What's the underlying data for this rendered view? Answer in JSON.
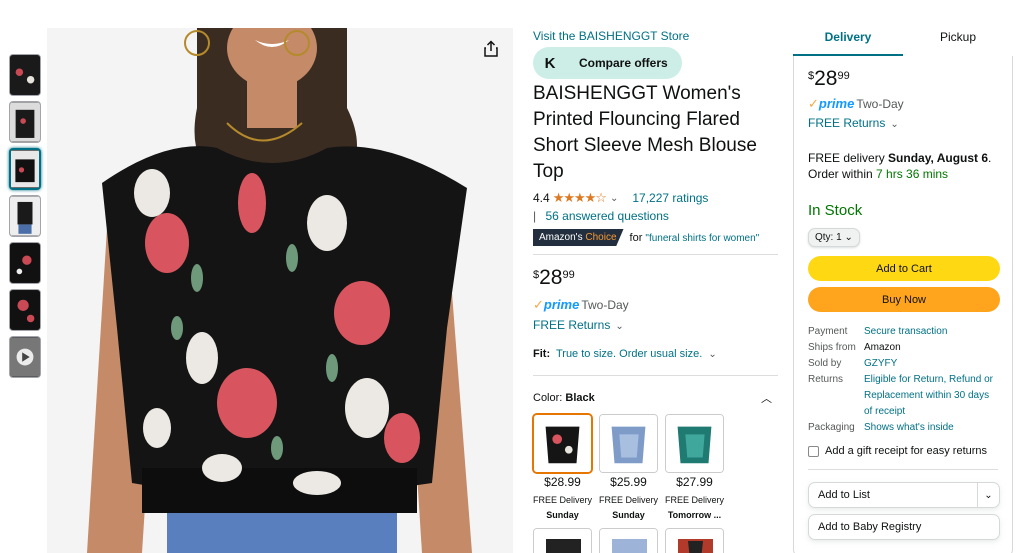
{
  "gallery": {
    "thumbnails": [
      "thumb-1",
      "thumb-2",
      "thumb-3",
      "thumb-4",
      "thumb-5",
      "thumb-6",
      "video-thumb"
    ],
    "share_icon": "share-icon"
  },
  "product": {
    "store_link": "Visit the BAISHENGGT Store",
    "compare_offers": "Compare offers",
    "compare_icon_letter": "K",
    "title": "BAISHENGGT Women's Printed Flouncing Flared Short Sleeve Mesh Blouse Top",
    "rating": "4.4",
    "stars": "★★★★☆",
    "ratings_count": "17,227 ratings",
    "answered_questions": "56 answered questions",
    "badge_prefix": "Amazon's",
    "badge_choice": "Choice",
    "badge_for": "for",
    "badge_query": "\"funeral shirts for women\"",
    "price_symbol": "$",
    "price_whole": "28",
    "price_fraction": "99",
    "prime": "prime",
    "two_day": "Two-Day",
    "free_returns": "FREE Returns",
    "fit_label": "Fit:",
    "fit_value": "True to size. Order usual size.",
    "color_label": "Color:",
    "color_value": "Black"
  },
  "swatches": [
    {
      "price": "$28.99",
      "delivery": "FREE Delivery",
      "day": "Sunday"
    },
    {
      "price": "$25.99",
      "delivery": "FREE Delivery",
      "day": "Sunday"
    },
    {
      "price": "$27.99",
      "delivery": "FREE Delivery",
      "day": "Tomorrow ..."
    }
  ],
  "buybox": {
    "tab_delivery": "Delivery",
    "tab_pickup": "Pickup",
    "price_symbol": "$",
    "price_whole": "28",
    "price_fraction": "99",
    "prime": "prime",
    "two_day": "Two-Day",
    "free_returns": "FREE Returns",
    "free_delivery": "FREE delivery",
    "delivery_date": "Sunday, August 6",
    "order_within": "Order within",
    "countdown": "7 hrs 36 mins",
    "in_stock": "In Stock",
    "qty": "Qty: 1",
    "add_to_cart": "Add to Cart",
    "buy_now": "Buy Now",
    "info": [
      {
        "key": "Payment",
        "value": "Secure transaction",
        "link": true
      },
      {
        "key": "Ships from",
        "value": "Amazon",
        "link": false
      },
      {
        "key": "Sold by",
        "value": "GZYFY",
        "link": true
      },
      {
        "key": "Returns",
        "value": "Eligible for Return, Refund or Replacement within 30 days of receipt",
        "link": true
      },
      {
        "key": "Packaging",
        "value": "Shows what's inside",
        "link": true
      }
    ],
    "gift_receipt": "Add a gift receipt for easy returns",
    "add_to_list": "Add to List",
    "add_to_baby_registry": "Add to Baby Registry"
  },
  "colors": {
    "link": "#007185",
    "cart_button": "#ffd814",
    "buy_button": "#ffa41c",
    "in_stock": "#007600",
    "star": "#de7921"
  }
}
